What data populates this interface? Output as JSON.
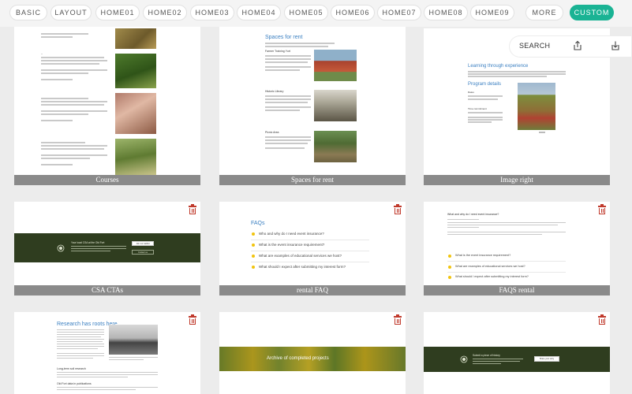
{
  "tabs": [
    {
      "label": "BASIC",
      "active": false
    },
    {
      "label": "LAYOUT",
      "active": false
    },
    {
      "label": "HOME01",
      "active": false
    },
    {
      "label": "HOME02",
      "active": false
    },
    {
      "label": "HOME03",
      "active": false
    },
    {
      "label": "HOME04",
      "active": false
    },
    {
      "label": "HOME05",
      "active": false
    },
    {
      "label": "HOME06",
      "active": false
    },
    {
      "label": "HOME07",
      "active": false
    },
    {
      "label": "HOME08",
      "active": false
    },
    {
      "label": "HOME09",
      "active": false
    },
    {
      "label": "MORE",
      "active": false
    },
    {
      "label": "CUSTOM",
      "active": true
    }
  ],
  "toolbar": {
    "search_label": "SEARCH",
    "share_icon": "share-icon",
    "download_icon": "download-icon"
  },
  "cards": {
    "courses": {
      "caption": "Courses"
    },
    "spaces": {
      "caption": "Spaces for rent",
      "heading": "Spaces for rent",
      "items": [
        "Farmer Training Yurt",
        "Historic Library",
        "Picnic Area"
      ]
    },
    "image_right": {
      "caption": "Image right",
      "heading": "Learning through experience",
      "subheading": "Program details",
      "labels": [
        "Dates",
        "Time commitment"
      ]
    },
    "csa": {
      "caption": "CSA CTAs",
      "title": "Your local CSA at the Old Fort",
      "buttons": [
        "Join our waitlist",
        "Contact us"
      ]
    },
    "rental_faq": {
      "caption": "rental FAQ",
      "heading": "FAQs",
      "questions": [
        "Who and why do I need event insurance?",
        "What is the event insurance requirement?",
        "What are examples of educational services we host?",
        "What should I expect after submitting my interest form?"
      ]
    },
    "faqs_rental": {
      "caption": "FAQS rental",
      "questions": [
        "What is the event insurance requirement?",
        "What are examples of educational services we host?",
        "What should I expect after submitting my interest form?"
      ],
      "top_question": "What and why do I need event insurance?"
    },
    "research": {
      "heading": "Research has roots here",
      "subheadings": [
        "Long-term soil research",
        "Old Fort data in publications"
      ]
    },
    "archive": {
      "title": "Archive of completed projects"
    },
    "history": {
      "title": "Submit a piece of history",
      "button": "Share your story"
    }
  },
  "colors": {
    "accent": "#1ab394",
    "caption_bg": "#8a8a8a",
    "trash": "#c0392b",
    "dark_green": "#2f3d1f",
    "link_blue": "#3a7fc1"
  }
}
